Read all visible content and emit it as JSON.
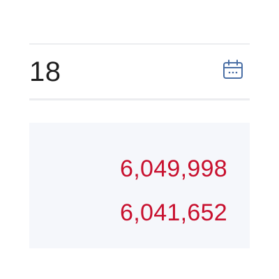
{
  "date_field": {
    "value": "18",
    "icon": "calendar-icon",
    "icon_color": "#4a6fa5"
  },
  "results": {
    "values": [
      "6,049,998",
      "6,041,652"
    ],
    "value_color": "#c8102e",
    "panel_background": "#f5f7fb"
  }
}
